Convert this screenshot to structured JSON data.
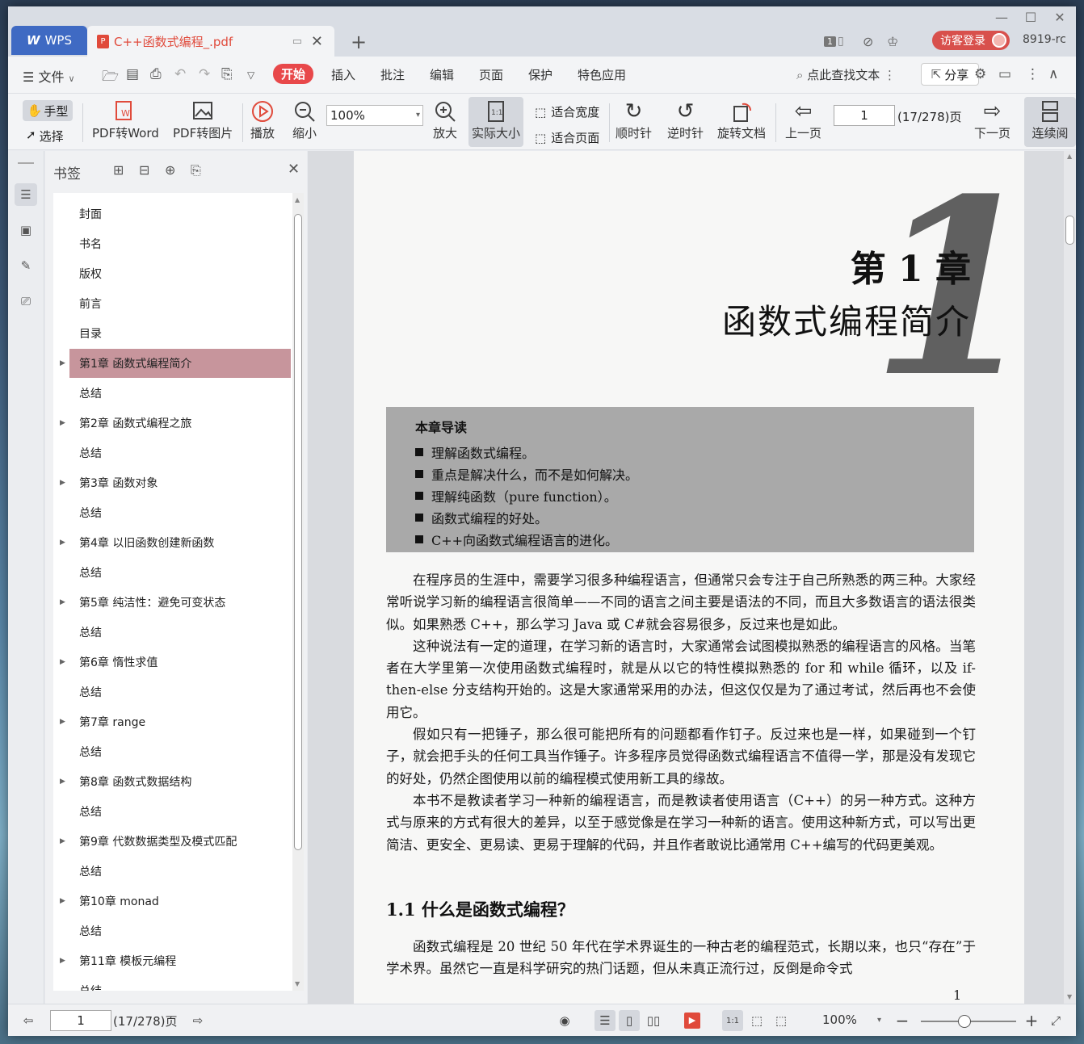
{
  "window": {
    "app_tab": "WPS",
    "doc_tab": "C++函数式编程_.pdf",
    "user_label": "8919-rc",
    "login_label": "访客登录"
  },
  "menu": {
    "file": "文件",
    "tabs": [
      "开始",
      "插入",
      "批注",
      "编辑",
      "页面",
      "保护",
      "特色应用"
    ],
    "active_tab": "开始",
    "search_label": "点此查找文本",
    "share": "分享"
  },
  "toolbar": {
    "hand": "手型",
    "select": "选择",
    "pdf_to_word": "PDF转Word",
    "pdf_to_image": "PDF转图片",
    "play": "播放",
    "zoom_out": "缩小",
    "zoom_value": "100%",
    "zoom_in": "放大",
    "actual_size": "实际大小",
    "fit_width": "适合宽度",
    "fit_page": "适合页面",
    "clockwise": "顺时针",
    "counterclockwise": "逆时针",
    "rotate_doc": "旋转文档",
    "prev_page": "上一页",
    "page_value": "1",
    "page_count": "(17/278)页",
    "next_page": "下一页",
    "continuous": "连续阅"
  },
  "bookmarks": {
    "title": "书签",
    "items": [
      {
        "label": "封面",
        "expandable": false
      },
      {
        "label": "书名",
        "expandable": false
      },
      {
        "label": "版权",
        "expandable": false
      },
      {
        "label": "前言",
        "expandable": false
      },
      {
        "label": "目录",
        "expandable": false
      },
      {
        "label": "第1章 函数式编程简介",
        "expandable": true,
        "active": true
      },
      {
        "label": "总结",
        "expandable": false
      },
      {
        "label": "第2章 函数式编程之旅",
        "expandable": true
      },
      {
        "label": "总结",
        "expandable": false
      },
      {
        "label": "第3章 函数对象",
        "expandable": true
      },
      {
        "label": "总结",
        "expandable": false
      },
      {
        "label": "第4章 以旧函数创建新函数",
        "expandable": true
      },
      {
        "label": "总结",
        "expandable": false
      },
      {
        "label": "第5章 纯洁性：避免可变状态",
        "expandable": true
      },
      {
        "label": "总结",
        "expandable": false
      },
      {
        "label": "第6章 惰性求值",
        "expandable": true
      },
      {
        "label": "总结",
        "expandable": false
      },
      {
        "label": "第7章 range",
        "expandable": true
      },
      {
        "label": "总结",
        "expandable": false
      },
      {
        "label": "第8章 函数式数据结构",
        "expandable": true
      },
      {
        "label": "总结",
        "expandable": false
      },
      {
        "label": "第9章 代数数据类型及模式匹配",
        "expandable": true
      },
      {
        "label": "总结",
        "expandable": false
      },
      {
        "label": "第10章 monad",
        "expandable": true
      },
      {
        "label": "总结",
        "expandable": false
      },
      {
        "label": "第11章 模板元编程",
        "expandable": true
      },
      {
        "label": "总结",
        "expandable": false
      }
    ]
  },
  "page": {
    "big_numeral": "1",
    "chapter": "第 1 章",
    "chapter_title": "函数式编程简介",
    "guide_title": "本章导读",
    "guide_items": [
      "理解函数式编程。",
      "重点是解决什么，而不是如何解决。",
      "理解纯函数（pure function）。",
      "函数式编程的好处。",
      "C++向函数式编程语言的进化。"
    ],
    "paragraphs": [
      "在程序员的生涯中，需要学习很多种编程语言，但通常只会专注于自己所熟悉的两三种。大家经常听说学习新的编程语言很简单——不同的语言之间主要是语法的不同，而且大多数语言的语法很类似。如果熟悉 C++，那么学习 Java 或 C#就会容易很多，反过来也是如此。",
      "这种说法有一定的道理，在学习新的语言时，大家通常会试图模拟熟悉的编程语言的风格。当笔者在大学里第一次使用函数式编程时，就是从以它的特性模拟熟悉的 for 和 while 循环，以及 if-then-else 分支结构开始的。这是大家通常采用的办法，但这仅仅是为了通过考试，然后再也不会使用它。",
      "假如只有一把锤子，那么很可能把所有的问题都看作钉子。反过来也是一样，如果碰到一个钉子，就会把手头的任何工具当作锤子。许多程序员觉得函数式编程语言不值得一学，那是没有发现它的好处，仍然企图使用以前的编程模式使用新工具的缘故。",
      "本书不是教读者学习一种新的编程语言，而是教读者使用语言（C++）的另一种方式。这种方式与原来的方式有很大的差异，以至于感觉像是在学习一种新的语言。使用这种新方式，可以写出更简洁、更安全、更易读、更易于理解的代码，并且作者敢说比通常用 C++编写的代码更美观。"
    ],
    "section_heading": "1.1   什么是函数式编程？",
    "section_para": "函数式编程是 20 世纪 50 年代在学术界诞生的一种古老的编程范式，长期以来，也只“存在”于学术界。虽然它一直是科学研究的热门话题，但从未真正流行过，反倒是命令式",
    "page_number": "1"
  },
  "status": {
    "page_value": "1",
    "page_count": "(17/278)页",
    "zoom": "100%"
  },
  "colors": {
    "accent": "#e8484a",
    "wps_blue": "#3f6ac3",
    "bookmark_active": "#c7959c"
  }
}
